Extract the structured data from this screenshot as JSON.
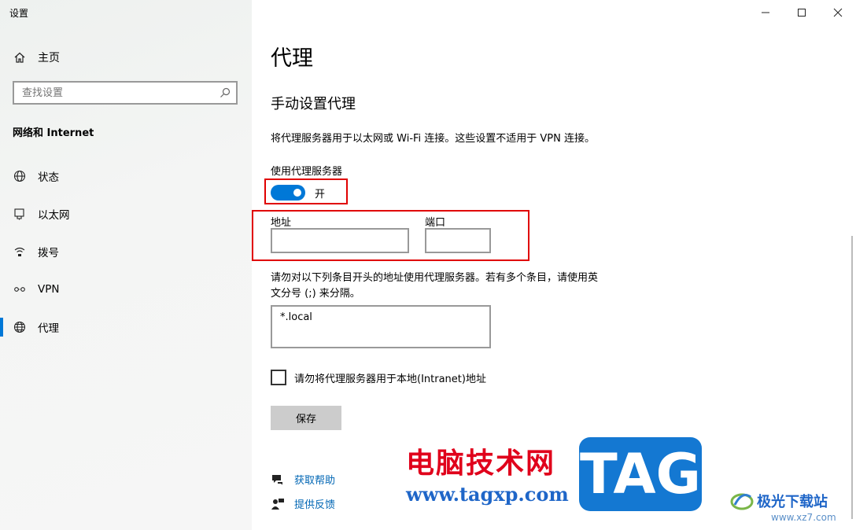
{
  "app": {
    "title": "设置"
  },
  "sidebar": {
    "home_label": "主页",
    "search_placeholder": "查找设置",
    "section_title": "网络和 Internet",
    "items": [
      {
        "label": "状态",
        "icon": "globe-status-icon"
      },
      {
        "label": "以太网",
        "icon": "ethernet-icon"
      },
      {
        "label": "拨号",
        "icon": "dialup-icon"
      },
      {
        "label": "VPN",
        "icon": "vpn-icon"
      },
      {
        "label": "代理",
        "icon": "globe-icon",
        "selected": true
      }
    ]
  },
  "main": {
    "page_title": "代理",
    "section_title": "手动设置代理",
    "description": "将代理服务器用于以太网或 Wi-Fi 连接。这些设置不适用于 VPN 连接。",
    "use_proxy_label": "使用代理服务器",
    "toggle_state": "开",
    "address_label": "地址",
    "address_value": "",
    "port_label": "端口",
    "port_value": "",
    "exceptions_text_line1": "请勿对以下列条目开头的地址使用代理服务器。若有多个条目，请使用英",
    "exceptions_text_line2": "文分号 (;) 来分隔。",
    "exceptions_value": "*.local",
    "bypass_local_label": "请勿将代理服务器用于本地(Intranet)地址",
    "bypass_local_checked": false,
    "save_label": "保存",
    "help_link": "获取帮助",
    "feedback_link": "提供反馈"
  },
  "watermark": {
    "cn_text": "电脑技术网",
    "url": "www.tagxp.com",
    "tag": "TAG",
    "xz_name": "极光下载站",
    "xz_url": "www.xz7.com"
  },
  "colors": {
    "accent": "#0078d7",
    "highlight_box": "#e00000",
    "link": "#0066b4"
  }
}
